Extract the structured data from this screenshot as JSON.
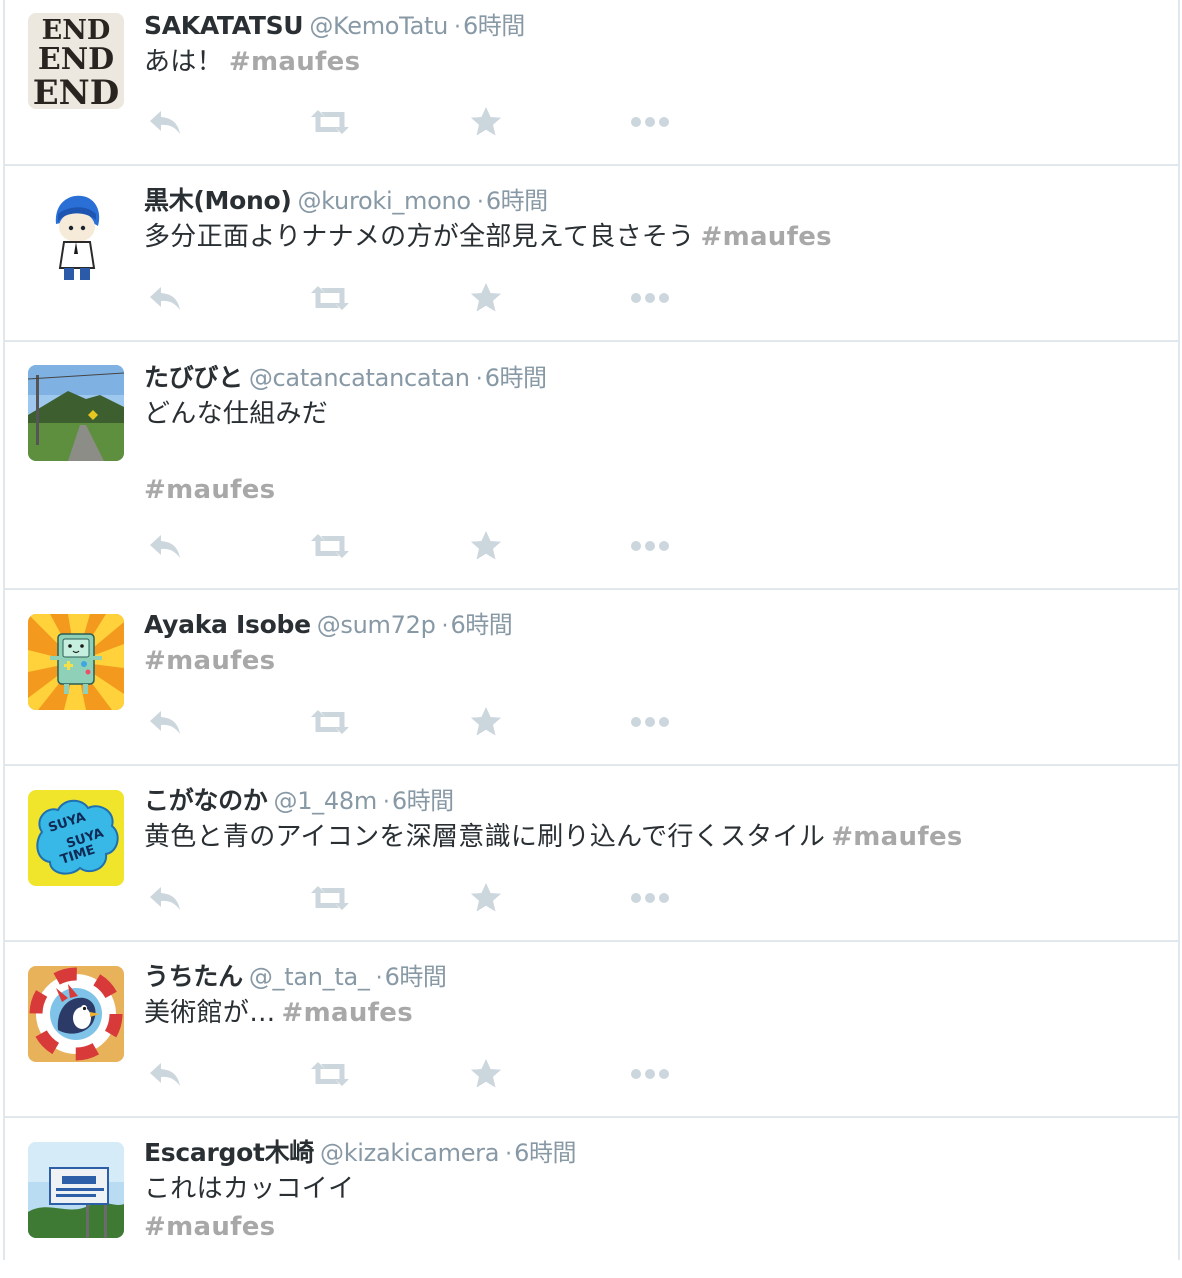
{
  "tweets": [
    {
      "fullname": "SAKATATSU",
      "username": "@KemoTatu",
      "time": "6時間",
      "text": "あは！",
      "hashtag": "#maufes",
      "avatar": "end-logo-avatar"
    },
    {
      "fullname": "黒木(Mono)",
      "username": "@kuroki_mono",
      "time": "6時間",
      "text": "多分正面よりナナメの方が全部見えて良さそう",
      "hashtag": "#maufes",
      "avatar": "anime-character-avatar"
    },
    {
      "fullname": "たびびと",
      "username": "@catancatancatan",
      "time": "6時間",
      "text": "どんな仕組みだ",
      "hashtag": "#maufes",
      "avatar": "country-road-photo-avatar"
    },
    {
      "fullname": "Ayaka Isobe",
      "username": "@sum72p",
      "time": "6時間",
      "text": "",
      "hashtag": "#maufes",
      "avatar": "robot-character-avatar"
    },
    {
      "fullname": "こがなのか",
      "username": "@1_48m",
      "time": "6時間",
      "text": "黄色と青のアイコンを深層意識に刷り込んで行くスタイル",
      "hashtag": "#maufes",
      "avatar": "suya-suya-time-avatar"
    },
    {
      "fullname": "うちたん",
      "username": "@_tan_ta_",
      "time": "6時間",
      "text": "美術館が…",
      "hashtag": "#maufes",
      "avatar": "penguin-lifebuoy-avatar"
    },
    {
      "fullname": "Escargot木崎",
      "username": "@kizakicamera",
      "time": "6時間",
      "text": "これはカッコイイ",
      "hashtag": "#maufes",
      "avatar": "road-sign-photo-avatar"
    }
  ],
  "colors": {
    "text": "#292f33",
    "meta": "#8899a6",
    "hashtag": "#a8a8a8",
    "action_icon": "#ccd6dd",
    "divider": "#e1e8ed"
  },
  "action_icons": [
    "reply-icon",
    "retweet-icon",
    "favorite-icon",
    "more-icon"
  ]
}
